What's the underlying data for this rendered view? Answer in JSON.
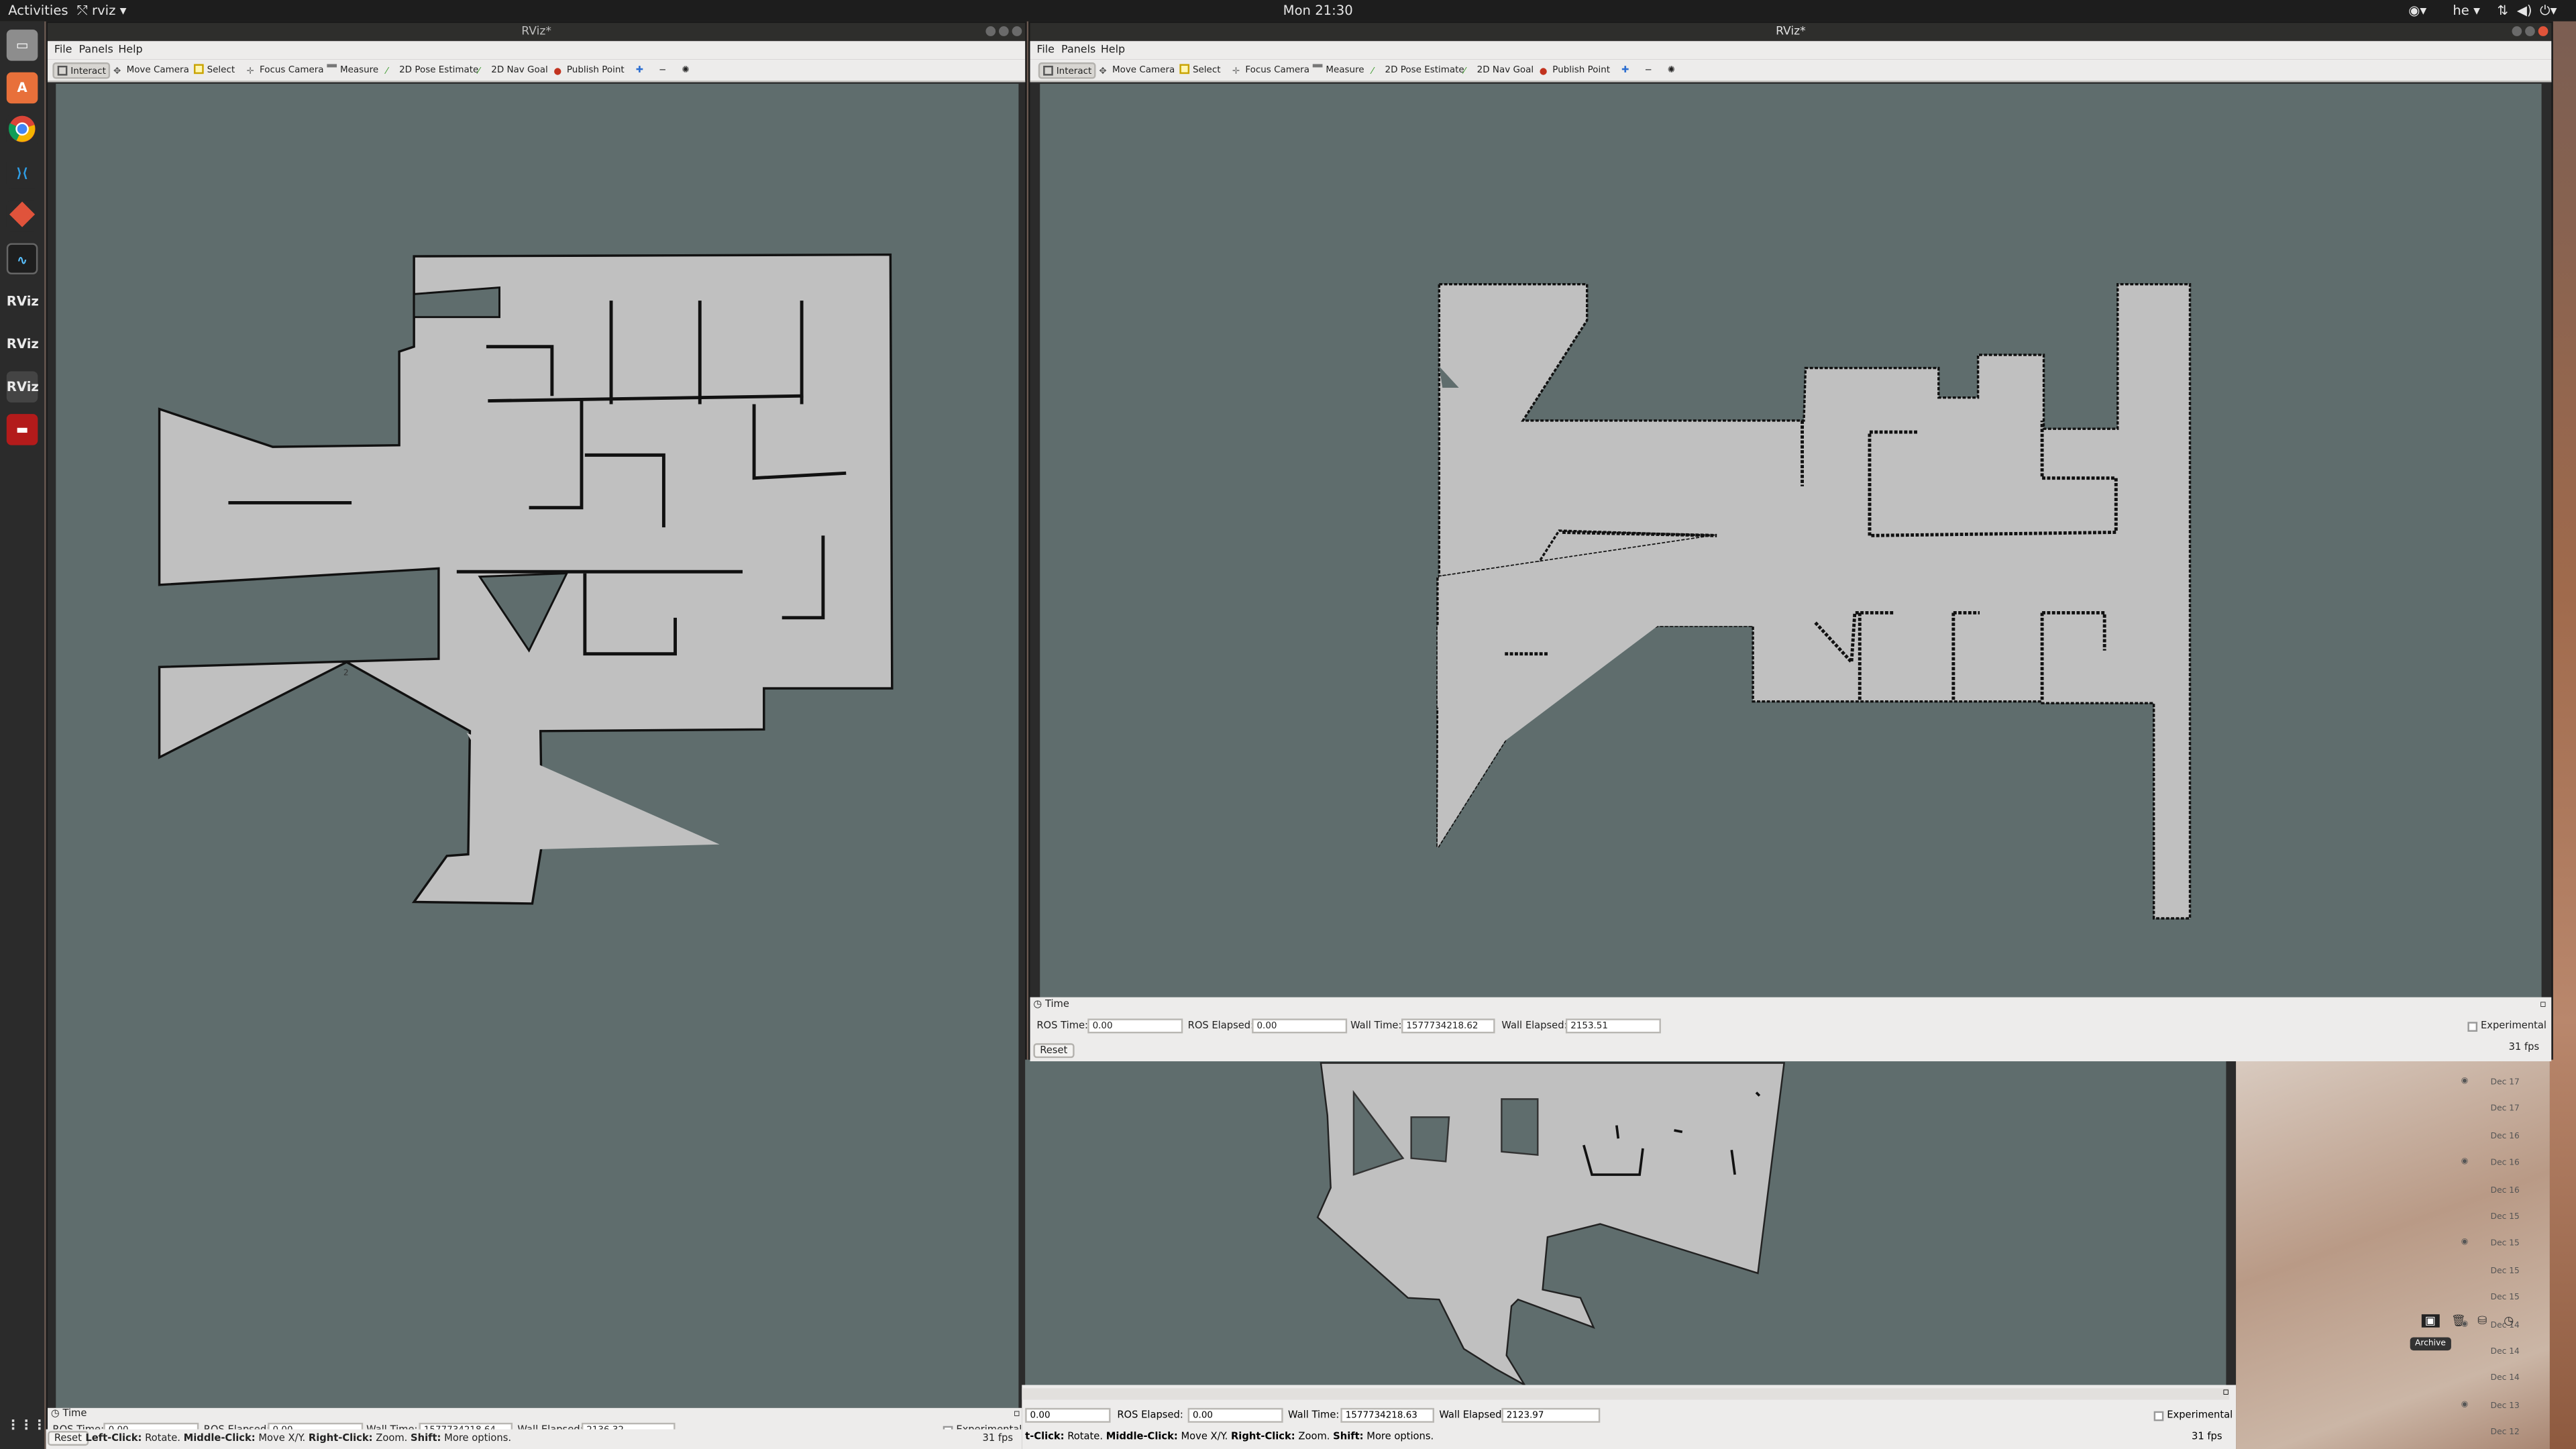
{
  "topbar": {
    "activities": "Activities",
    "app_menu": "rviz",
    "clock": "Mon 21:30",
    "lang": "he"
  },
  "dock": {
    "items": [
      "files",
      "software",
      "chrome",
      "vscode",
      "git",
      "monitor",
      "RViz",
      "RViz",
      "RViz",
      "terminal"
    ],
    "rviz_label": "RViz"
  },
  "left_window": {
    "title": "RViz*",
    "menu": [
      "File",
      "Panels",
      "Help"
    ],
    "tools": [
      "Interact",
      "Move Camera",
      "Select",
      "Focus Camera",
      "Measure",
      "2D Pose Estimate",
      "2D Nav Goal",
      "Publish Point"
    ],
    "time_panel_title": "Time",
    "ros_time_label": "ROS Time:",
    "ros_time": "0.00",
    "ros_elapsed_label": "ROS Elapsed:",
    "ros_elapsed": "0.00",
    "wall_time_label": "Wall Time:",
    "wall_time": "1577734218.64",
    "wall_elapsed_label": "Wall Elapsed:",
    "wall_elapsed": "2136.32",
    "experimental": "Experimental",
    "reset": "Reset",
    "fps": "31 fps",
    "hint_left_click": "Left-Click:",
    "hint_rotate": "Rotate.",
    "hint_middle_click": "Middle-Click:",
    "hint_move": "Move X/Y.",
    "hint_right_click": "Right-Click:",
    "hint_zoom": "Zoom.",
    "hint_shift": "Shift:",
    "hint_more": "More options."
  },
  "mid_window": {
    "ros_time": "0.00",
    "ros_elapsed_label": "ROS Elapsed:",
    "ros_elapsed": "0.00",
    "wall_time_label": "Wall Time:",
    "wall_time": "1577734218.63",
    "wall_elapsed_label": "Wall Elapsed:",
    "wall_elapsed": "2123.97",
    "experimental": "Experimental",
    "fps": "31 fps",
    "hint_left_click": "t-Click:",
    "hint_rotate": "Rotate.",
    "hint_middle_click": "Middle-Click:",
    "hint_move": "Move X/Y.",
    "hint_right_click": "Right-Click:",
    "hint_zoom": "Zoom.",
    "hint_shift": "Shift:",
    "hint_more": "More options."
  },
  "right_window": {
    "title": "RViz*",
    "menu": [
      "File",
      "Panels",
      "Help"
    ],
    "tools": [
      "Interact",
      "Move Camera",
      "Select",
      "Focus Camera",
      "Measure",
      "2D Pose Estimate",
      "2D Nav Goal",
      "Publish Point"
    ],
    "time_panel_title": "Time",
    "ros_time_label": "ROS Time:",
    "ros_time": "0.00",
    "ros_elapsed_label": "ROS Elapsed:",
    "ros_elapsed": "0.00",
    "wall_time_label": "Wall Time:",
    "wall_time": "1577734218.62",
    "wall_elapsed_label": "Wall Elapsed:",
    "wall_elapsed": "2153.51",
    "experimental": "Experimental",
    "reset": "Reset",
    "fps": "31 fps"
  },
  "desktop_list": {
    "dates": [
      "Dec 17",
      "Dec 17",
      "Dec 16",
      "Dec 16",
      "Dec 16",
      "Dec 15",
      "Dec 15",
      "Dec 15",
      "Dec 15",
      "Dec 14",
      "Dec 14",
      "Dec 14",
      "Dec 13",
      "Dec 12"
    ],
    "tooltip": "Archive"
  },
  "colors": {
    "map_free": "#c0c0c0",
    "map_bg": "#5f6d6d",
    "wall": "#111111"
  }
}
